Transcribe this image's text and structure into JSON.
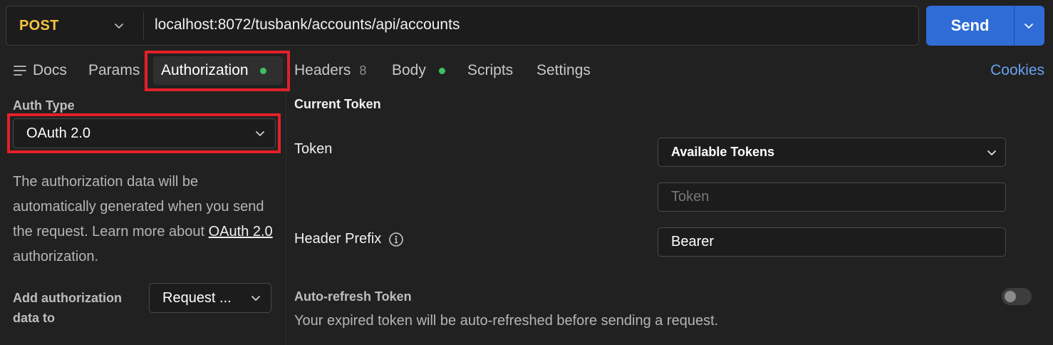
{
  "request": {
    "method": "POST",
    "url": "localhost:8072/tusbank/accounts/api/accounts",
    "send_label": "Send"
  },
  "tabs": {
    "docs": "Docs",
    "params": "Params",
    "authorization": "Authorization",
    "headers": "Headers",
    "headers_count": "8",
    "body": "Body",
    "scripts": "Scripts",
    "settings": "Settings",
    "cookies": "Cookies"
  },
  "auth": {
    "type_label": "Auth Type",
    "type_value": "OAuth 2.0",
    "desc_text": "The authorization data will be automatically generated when you send the request. Learn more about ",
    "desc_link": "OAuth 2.0",
    "desc_suffix": " authorization.",
    "add_to_label": "Add authorization data to",
    "add_to_value": "Request ..."
  },
  "token": {
    "section_title": "Current Token",
    "token_label": "Token",
    "available_tokens": "Available Tokens",
    "token_placeholder": "Token",
    "header_prefix_label": "Header Prefix",
    "header_prefix_value": "Bearer",
    "auto_refresh_label": "Auto-refresh Token",
    "auto_refresh_desc": "Your expired token will be auto-refreshed before sending a request.",
    "auto_refresh_enabled": false
  },
  "colors": {
    "method": "#f5c542",
    "send_button": "#2f6cd6",
    "link": "#6aa2f2",
    "status_dot": "#3fbf62",
    "highlight": "#e3202a"
  }
}
